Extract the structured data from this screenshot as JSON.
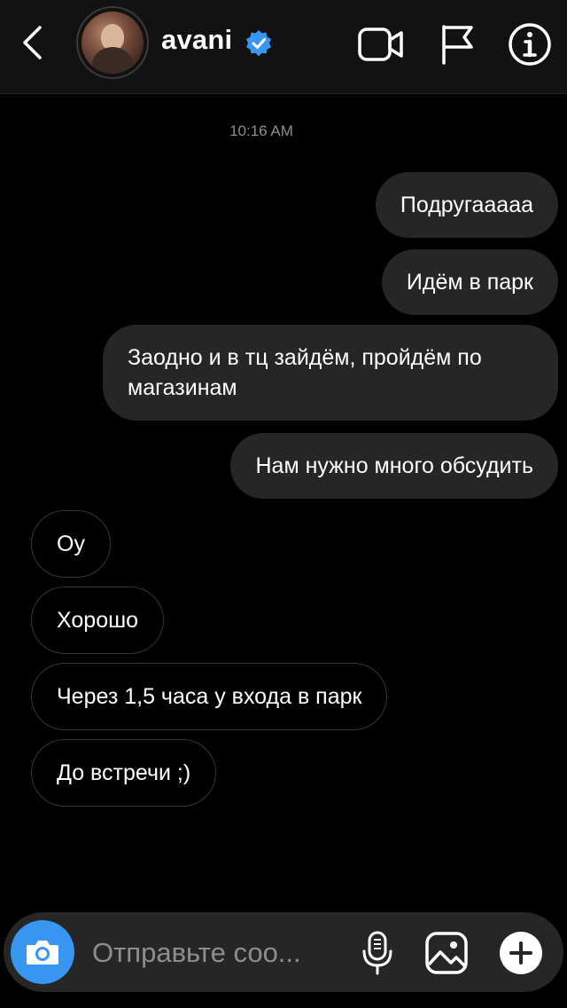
{
  "header": {
    "username": "avani",
    "verified_color": "#3897f0",
    "icons": [
      "back-icon",
      "video-call-icon",
      "flag-icon",
      "info-icon"
    ]
  },
  "thread": {
    "timestamp": "10:16 AM",
    "messages": [
      {
        "direction": "outgoing",
        "text": "Подругааааа"
      },
      {
        "direction": "outgoing",
        "text": "Идём в парк"
      },
      {
        "direction": "outgoing",
        "text": "Заодно и в тц зайдём, пройдём по магазинам"
      },
      {
        "direction": "outgoing",
        "text": "Нам нужно много обсудить"
      },
      {
        "direction": "incoming",
        "text": "Оу"
      },
      {
        "direction": "incoming",
        "text": "Хорошо"
      },
      {
        "direction": "incoming",
        "text": "Через 1,5 часа у входа в парк"
      },
      {
        "direction": "incoming",
        "text": "До встречи ;)"
      }
    ]
  },
  "composer": {
    "placeholder": "Отправьте соо...",
    "value": "",
    "accent": "#3797f0",
    "icons": [
      "camera-icon",
      "microphone-icon",
      "gallery-icon",
      "plus-icon"
    ]
  }
}
